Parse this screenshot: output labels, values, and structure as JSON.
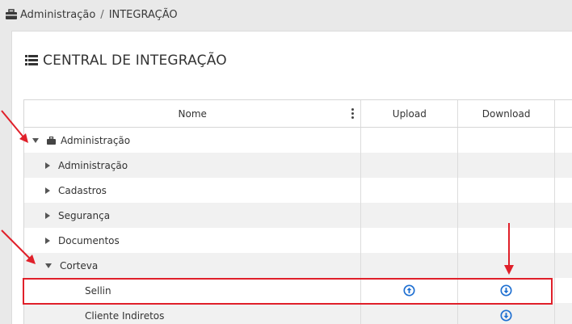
{
  "breadcrumb": {
    "icon": "briefcase-icon",
    "section": "Administração",
    "separator": "/",
    "page": "INTEGRAÇÃO"
  },
  "panel": {
    "icon": "list-icon",
    "title": "CENTRAL DE INTEGRAÇÃO"
  },
  "grid": {
    "columns": {
      "name": "Nome",
      "upload": "Upload",
      "download": "Download"
    },
    "rows": [
      {
        "label": "Administração",
        "level": 0,
        "expanded": true,
        "has_upload": false,
        "has_download": false
      },
      {
        "label": "Administração",
        "level": 1,
        "expanded": false,
        "has_upload": false,
        "has_download": false
      },
      {
        "label": "Cadastros",
        "level": 1,
        "expanded": false,
        "has_upload": false,
        "has_download": false
      },
      {
        "label": "Segurança",
        "level": 1,
        "expanded": false,
        "has_upload": false,
        "has_download": false
      },
      {
        "label": "Documentos",
        "level": 1,
        "expanded": false,
        "has_upload": false,
        "has_download": false
      },
      {
        "label": "Corteva",
        "level": 1,
        "expanded": true,
        "has_upload": false,
        "has_download": false
      },
      {
        "label": "Sellin",
        "level": 2,
        "has_upload": true,
        "has_download": true
      },
      {
        "label": "Cliente Indiretos",
        "level": 2,
        "has_upload": false,
        "has_download": true
      }
    ]
  },
  "colors": {
    "accent_blue": "#1e6fd1",
    "annotation_red": "#e0202a"
  }
}
